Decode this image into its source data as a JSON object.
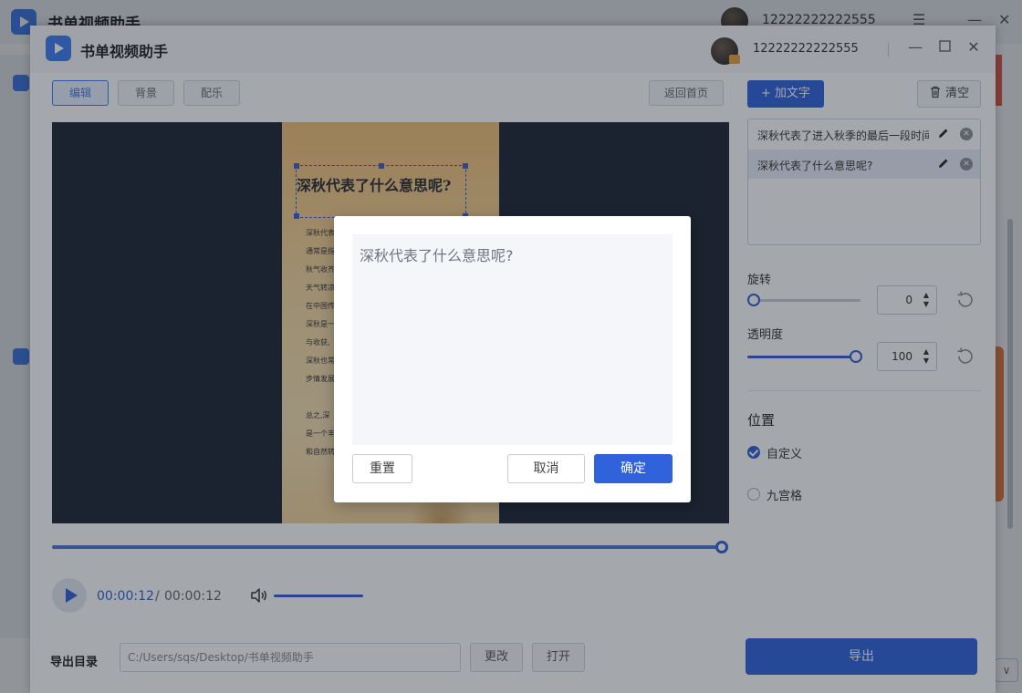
{
  "background_window": {
    "title": "书单视频助手",
    "username": "12222222222555",
    "menu_icon": "menu-icon",
    "minimize_icon": "minimize-icon",
    "close_icon": "close-icon"
  },
  "window": {
    "title": "书单视频助手",
    "username": "12222222222555",
    "controls": [
      "minimize-icon",
      "maximize-icon",
      "close-icon"
    ]
  },
  "editor": {
    "tabs": [
      {
        "label": "编辑",
        "active": true
      },
      {
        "label": "背景",
        "active": false
      },
      {
        "label": "配乐",
        "active": false
      }
    ],
    "home_button": "返回首页",
    "preview": {
      "title": "深秋代表了什么意思呢?",
      "body_lines": [
        "深秋代表",
        "通常是指",
        "秋气收齐",
        "天气转凉",
        "在中国传",
        "深秋是一",
        "与收获,",
        "深秋也常",
        "步情发展",
        "",
        "总之,深",
        "是一个丰",
        "和自然转"
      ]
    },
    "playback": {
      "current_time": "00:00:12",
      "separator": "/",
      "total_time": "00:00:12",
      "progress": 1.0,
      "volume_icon": "volume-icon"
    }
  },
  "export": {
    "label": "导出目录",
    "path": "C:/Users/sqs/Desktop/书单视频助手",
    "change_button": "更改",
    "open_button": "打开",
    "export_button": "导出"
  },
  "panel": {
    "add_text_button": "+ 加文字",
    "clear_button": "清空",
    "text_items": [
      {
        "label": "深秋代表了进入秋季的最后一段时间",
        "selected": false
      },
      {
        "label": "深秋代表了什么意思呢?",
        "selected": true
      }
    ],
    "rotation": {
      "label": "旋转",
      "value": "0"
    },
    "opacity": {
      "label": "透明度",
      "value": "100"
    },
    "position": {
      "title": "位置",
      "options": [
        {
          "label": "自定义",
          "checked": true
        },
        {
          "label": "九宫格",
          "checked": false
        }
      ]
    }
  },
  "dialog": {
    "text": "深秋代表了什么意思呢?",
    "reset_button": "重置",
    "cancel_button": "取消",
    "confirm_button": "确定"
  },
  "colors": {
    "accent": "#2f62db",
    "stage_background": "#1b2331",
    "card_background": "#f6d79c"
  }
}
